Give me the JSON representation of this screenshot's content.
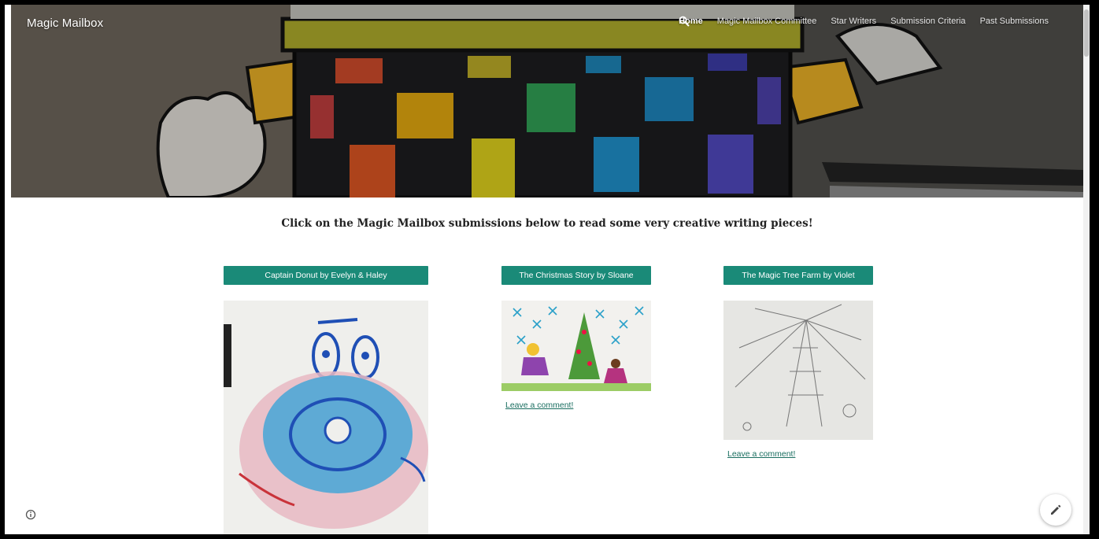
{
  "site": {
    "title": "Magic Mailbox"
  },
  "nav": {
    "items": [
      {
        "label": "Home",
        "active": true
      },
      {
        "label": "Magic Mailbox Committee",
        "active": false
      },
      {
        "label": "Star Writers",
        "active": false
      },
      {
        "label": "Submission Criteria",
        "active": false
      },
      {
        "label": "Past Submissions",
        "active": false
      }
    ],
    "search_icon": "search-icon"
  },
  "main": {
    "headline": "Click on the Magic Mailbox submissions below to read some very creative writing pieces!",
    "cards": [
      {
        "title": "Captain Donut by Evelyn & Haley",
        "comment": ""
      },
      {
        "title": "The Christmas Story by Sloane",
        "comment": "Leave a comment!"
      },
      {
        "title": "The Magic Tree Farm by Violet",
        "comment": "Leave a comment!"
      }
    ]
  },
  "icons": {
    "info": "info-icon",
    "edit": "pencil-icon"
  },
  "colors": {
    "accent": "#1a8a78",
    "link": "#1a6e60"
  }
}
